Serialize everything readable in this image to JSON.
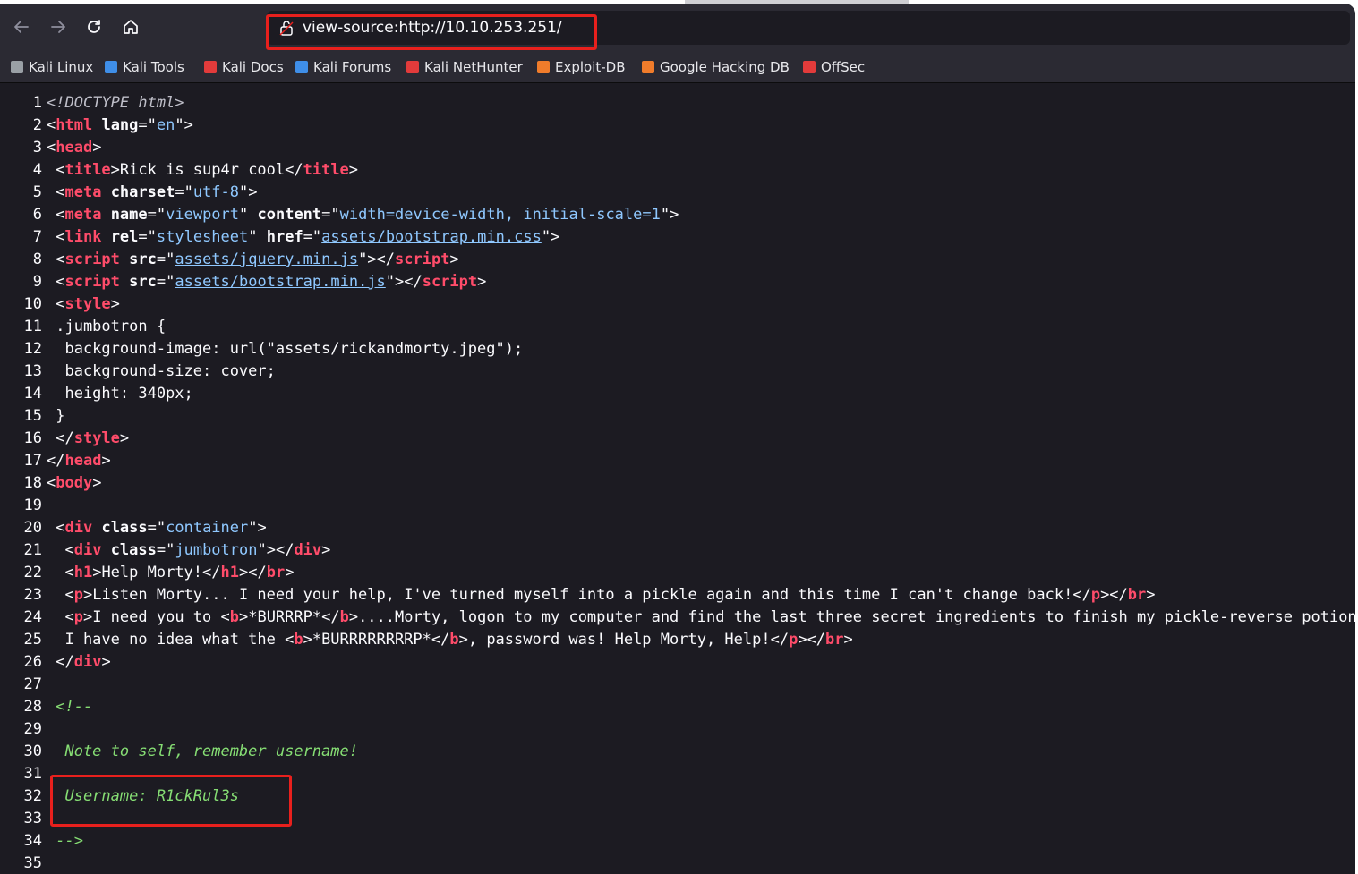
{
  "url": "view-source:http://10.10.253.251/",
  "bookmarks": [
    {
      "label": "Kali Linux",
      "icon": "kali-dragon-icon",
      "color": "#9aa0a6"
    },
    {
      "label": "Kali Tools",
      "icon": "kali-tools-icon",
      "color": "#3f8ee8"
    },
    {
      "label": "Kali Docs",
      "icon": "kali-docs-icon",
      "color": "#e23b3b"
    },
    {
      "label": "Kali Forums",
      "icon": "kali-forums-icon",
      "color": "#3f8ee8"
    },
    {
      "label": "Kali NetHunter",
      "icon": "kali-nethunter-icon",
      "color": "#e23b3b"
    },
    {
      "label": "Exploit-DB",
      "icon": "exploit-db-icon",
      "color": "#f07c2b"
    },
    {
      "label": "Google Hacking DB",
      "icon": "ghdb-icon",
      "color": "#f07c2b"
    },
    {
      "label": "OffSec",
      "icon": "offsec-icon",
      "color": "#e23b3b"
    }
  ],
  "source_lines": [
    [
      [
        "doctype",
        "<!DOCTYPE html>"
      ]
    ],
    [
      [
        "txt",
        "<"
      ],
      [
        "tag",
        "html"
      ],
      [
        "txt",
        " "
      ],
      [
        "attr",
        "lang"
      ],
      [
        "txt",
        "=\""
      ],
      [
        "val",
        "en"
      ],
      [
        "txt",
        "\">"
      ]
    ],
    [
      [
        "txt",
        "<"
      ],
      [
        "tag",
        "head"
      ],
      [
        "txt",
        ">"
      ]
    ],
    [
      [
        "txt",
        " <"
      ],
      [
        "tag",
        "title"
      ],
      [
        "txt",
        ">Rick is sup4r cool</"
      ],
      [
        "tag",
        "title"
      ],
      [
        "txt",
        ">"
      ]
    ],
    [
      [
        "txt",
        " <"
      ],
      [
        "tag",
        "meta"
      ],
      [
        "txt",
        " "
      ],
      [
        "attr",
        "charset"
      ],
      [
        "txt",
        "=\""
      ],
      [
        "val",
        "utf-8"
      ],
      [
        "txt",
        "\">"
      ]
    ],
    [
      [
        "txt",
        " <"
      ],
      [
        "tag",
        "meta"
      ],
      [
        "txt",
        " "
      ],
      [
        "attr",
        "name"
      ],
      [
        "txt",
        "=\""
      ],
      [
        "val",
        "viewport"
      ],
      [
        "txt",
        "\" "
      ],
      [
        "attr",
        "content"
      ],
      [
        "txt",
        "=\""
      ],
      [
        "val",
        "width=device-width, initial-scale=1"
      ],
      [
        "txt",
        "\">"
      ]
    ],
    [
      [
        "txt",
        " <"
      ],
      [
        "tag",
        "link"
      ],
      [
        "txt",
        " "
      ],
      [
        "attr",
        "rel"
      ],
      [
        "txt",
        "=\""
      ],
      [
        "val",
        "stylesheet"
      ],
      [
        "txt",
        "\" "
      ],
      [
        "attr",
        "href"
      ],
      [
        "txt",
        "=\""
      ],
      [
        "link",
        "assets/bootstrap.min.css"
      ],
      [
        "txt",
        "\">"
      ]
    ],
    [
      [
        "txt",
        " <"
      ],
      [
        "tag",
        "script"
      ],
      [
        "txt",
        " "
      ],
      [
        "attr",
        "src"
      ],
      [
        "txt",
        "=\""
      ],
      [
        "link",
        "assets/jquery.min.js"
      ],
      [
        "txt",
        "\"></"
      ],
      [
        "tag",
        "script"
      ],
      [
        "txt",
        ">"
      ]
    ],
    [
      [
        "txt",
        " <"
      ],
      [
        "tag",
        "script"
      ],
      [
        "txt",
        " "
      ],
      [
        "attr",
        "src"
      ],
      [
        "txt",
        "=\""
      ],
      [
        "link",
        "assets/bootstrap.min.js"
      ],
      [
        "txt",
        "\"></"
      ],
      [
        "tag",
        "script"
      ],
      [
        "txt",
        ">"
      ]
    ],
    [
      [
        "txt",
        " <"
      ],
      [
        "tag",
        "style"
      ],
      [
        "txt",
        ">"
      ]
    ],
    [
      [
        "txt",
        " .jumbotron {"
      ]
    ],
    [
      [
        "txt",
        "  background-image: url(\"assets/rickandmorty.jpeg\");"
      ]
    ],
    [
      [
        "txt",
        "  background-size: cover;"
      ]
    ],
    [
      [
        "txt",
        "  height: 340px;"
      ]
    ],
    [
      [
        "txt",
        " }"
      ]
    ],
    [
      [
        "txt",
        " </"
      ],
      [
        "tag",
        "style"
      ],
      [
        "txt",
        ">"
      ]
    ],
    [
      [
        "txt",
        "</"
      ],
      [
        "tag",
        "head"
      ],
      [
        "txt",
        ">"
      ]
    ],
    [
      [
        "txt",
        "<"
      ],
      [
        "tag",
        "body"
      ],
      [
        "txt",
        ">"
      ]
    ],
    [],
    [
      [
        "txt",
        " <"
      ],
      [
        "tag",
        "div"
      ],
      [
        "txt",
        " "
      ],
      [
        "attr",
        "class"
      ],
      [
        "txt",
        "=\""
      ],
      [
        "val",
        "container"
      ],
      [
        "txt",
        "\">"
      ]
    ],
    [
      [
        "txt",
        "  <"
      ],
      [
        "tag",
        "div"
      ],
      [
        "txt",
        " "
      ],
      [
        "attr",
        "class"
      ],
      [
        "txt",
        "=\""
      ],
      [
        "val",
        "jumbotron"
      ],
      [
        "txt",
        "\"></"
      ],
      [
        "tag",
        "div"
      ],
      [
        "txt",
        ">"
      ]
    ],
    [
      [
        "txt",
        "  <"
      ],
      [
        "tag",
        "h1"
      ],
      [
        "txt",
        ">Help Morty!</"
      ],
      [
        "tag",
        "h1"
      ],
      [
        "txt",
        "></"
      ],
      [
        "tag",
        "br"
      ],
      [
        "txt",
        ">"
      ]
    ],
    [
      [
        "txt",
        "  <"
      ],
      [
        "tag",
        "p"
      ],
      [
        "txt",
        ">Listen Morty... I need your help, I've turned myself into a pickle again and this time I can't change back!</"
      ],
      [
        "tag",
        "p"
      ],
      [
        "txt",
        "></"
      ],
      [
        "tag",
        "br"
      ],
      [
        "txt",
        ">"
      ]
    ],
    [
      [
        "txt",
        "  <"
      ],
      [
        "tag",
        "p"
      ],
      [
        "txt",
        ">I need you to <"
      ],
      [
        "tag",
        "b"
      ],
      [
        "txt",
        ">*BURRRP*</"
      ],
      [
        "tag",
        "b"
      ],
      [
        "txt",
        ">....Morty, logon to my computer and find the last three secret ingredients to finish my pickle-reverse potion. T"
      ]
    ],
    [
      [
        "txt",
        "  I have no idea what the <"
      ],
      [
        "tag",
        "b"
      ],
      [
        "txt",
        ">*BURRRRRRRRP*</"
      ],
      [
        "tag",
        "b"
      ],
      [
        "txt",
        ">, password was! Help Morty, Help!</"
      ],
      [
        "tag",
        "p"
      ],
      [
        "txt",
        "></"
      ],
      [
        "tag",
        "br"
      ],
      [
        "txt",
        ">"
      ]
    ],
    [
      [
        "txt",
        " </"
      ],
      [
        "tag",
        "div"
      ],
      [
        "txt",
        ">"
      ]
    ],
    [],
    [
      [
        "cmt",
        " <!--"
      ]
    ],
    [],
    [
      [
        "cmt",
        "  Note to self, remember username!"
      ]
    ],
    [],
    [
      [
        "cmt",
        "  Username: R1ckRul3s"
      ]
    ],
    [],
    [
      [
        "cmt",
        " -->"
      ]
    ],
    []
  ]
}
